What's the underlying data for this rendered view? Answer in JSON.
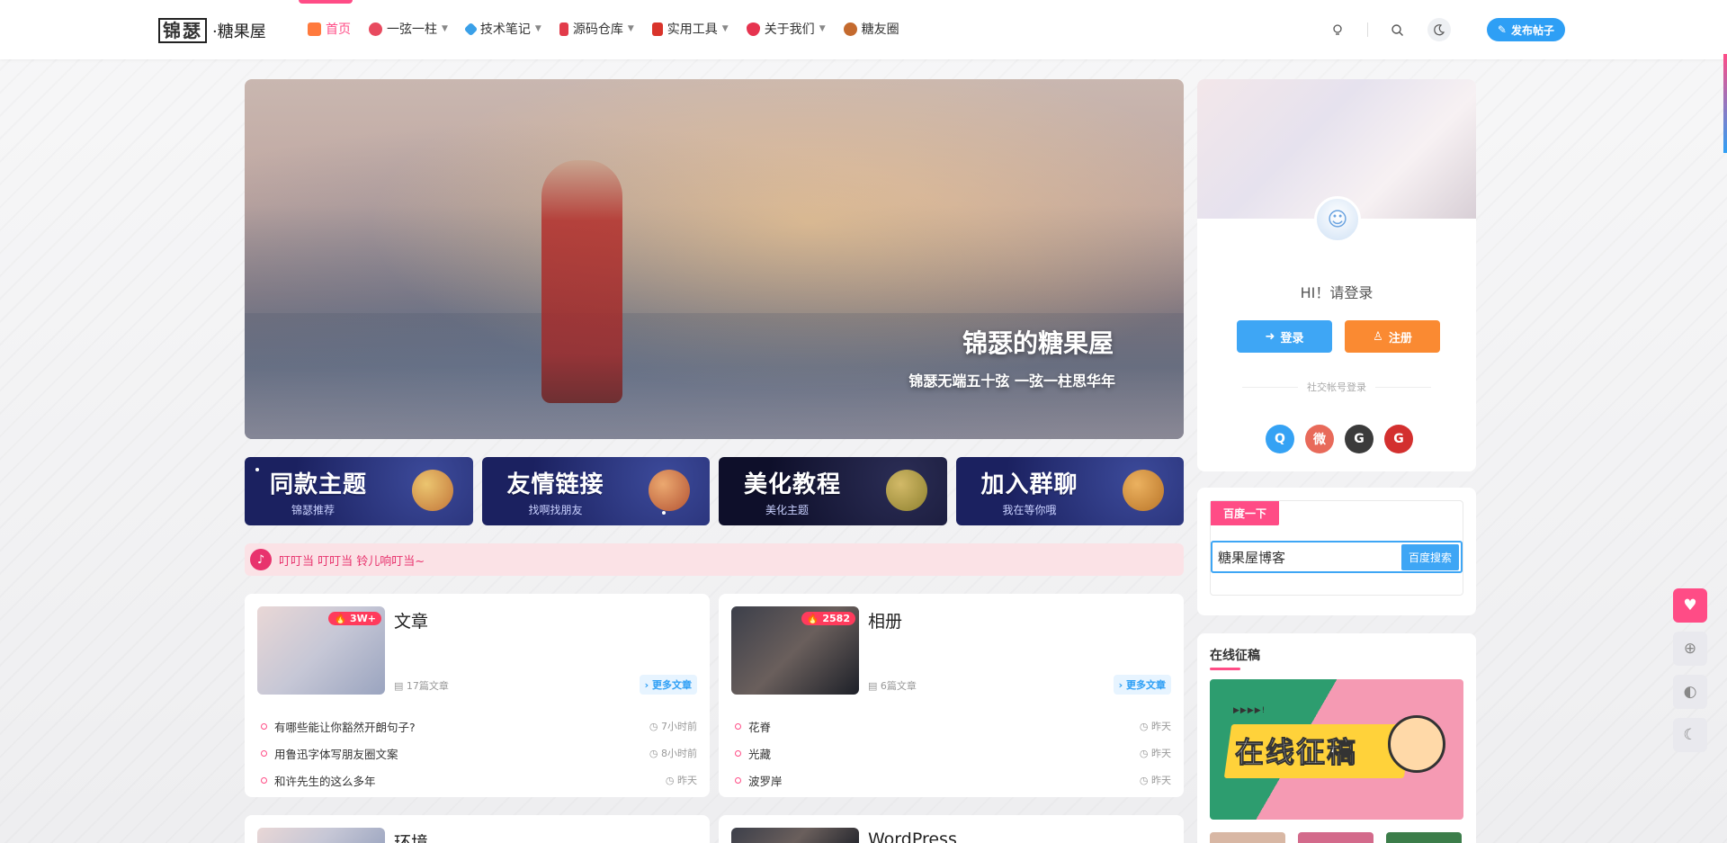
{
  "header": {
    "logo_boxed": "锦瑟",
    "logo_text": "·糖果屋",
    "nav": [
      {
        "label": "首页",
        "active": true,
        "icon": "home-icon",
        "color": "#ff7a3d",
        "dropdown": false
      },
      {
        "label": "一弦一柱",
        "active": false,
        "icon": "guitar-icon",
        "color": "#e84a5f",
        "dropdown": true
      },
      {
        "label": "技术笔记",
        "active": false,
        "icon": "rocket-icon",
        "color": "#3aa0e8",
        "dropdown": true
      },
      {
        "label": "源码仓库",
        "active": false,
        "icon": "bottle-icon",
        "color": "#e23b4a",
        "dropdown": true
      },
      {
        "label": "实用工具",
        "active": false,
        "icon": "calendar-icon",
        "color": "#d9342b",
        "dropdown": true
      },
      {
        "label": "关于我们",
        "active": false,
        "icon": "strawberry-icon",
        "color": "#e6334f",
        "dropdown": true
      },
      {
        "label": "糖友圈",
        "active": false,
        "icon": "candy-icon",
        "color": "#c46a2e",
        "dropdown": false
      }
    ],
    "publish_label": "发布帖子"
  },
  "banner": {
    "title": "锦瑟的糖果屋",
    "subtitle": "锦瑟无端五十弦 一弦一柱思华年"
  },
  "feature_cards": [
    {
      "title": "同款主题",
      "sub": "锦瑟推荐"
    },
    {
      "title": "友情链接",
      "sub": "找啊找朋友"
    },
    {
      "title": "美化教程",
      "sub": "美化主题"
    },
    {
      "title": "加入群聊",
      "sub": "我在等你哦"
    }
  ],
  "notice": {
    "text": "叮叮当 叮叮当 铃儿响叮当~"
  },
  "sections": [
    {
      "title": "文章",
      "hot": "3W+",
      "count": "17篇文章",
      "more": "更多文章",
      "items": [
        {
          "title": "有哪些能让你豁然开朗句子?",
          "time": "7小时前"
        },
        {
          "title": "用鲁迅字体写朋友圈文案",
          "time": "8小时前"
        },
        {
          "title": "和许先生的这么多年",
          "time": "昨天"
        }
      ]
    },
    {
      "title": "相册",
      "hot": "2582",
      "count": "6篇文章",
      "more": "更多文章",
      "items": [
        {
          "title": "花脊",
          "time": "昨天"
        },
        {
          "title": "光藏",
          "time": "昨天"
        },
        {
          "title": "波罗岸",
          "time": "昨天"
        }
      ]
    }
  ],
  "sections_next": [
    {
      "title": "环境"
    },
    {
      "title": "WordPress"
    }
  ],
  "sidebar": {
    "login": {
      "greeting": "HI！请登录",
      "login_label": "登录",
      "register_label": "注册",
      "social_label": "社交帐号登录",
      "social": [
        {
          "icon": "qq-icon",
          "glyph": "Q",
          "color": "#35a2f4"
        },
        {
          "icon": "weibo-icon",
          "glyph": "微",
          "color": "#e86a5a"
        },
        {
          "icon": "github-icon",
          "glyph": "G",
          "color": "#3b3b3b"
        },
        {
          "icon": "gitee-icon",
          "glyph": "G",
          "color": "#d3302f"
        }
      ]
    },
    "search": {
      "tag": "百度一下",
      "value": "糖果屋博客",
      "button": "百度搜索"
    },
    "contrib": {
      "title": "在线征稿",
      "image_text": "在线征稿",
      "arrows": "▶▶▶▶!"
    }
  },
  "colors": {
    "accent": "#ff4c86",
    "blue": "#2e9ff5",
    "orange": "#fa8a32"
  }
}
